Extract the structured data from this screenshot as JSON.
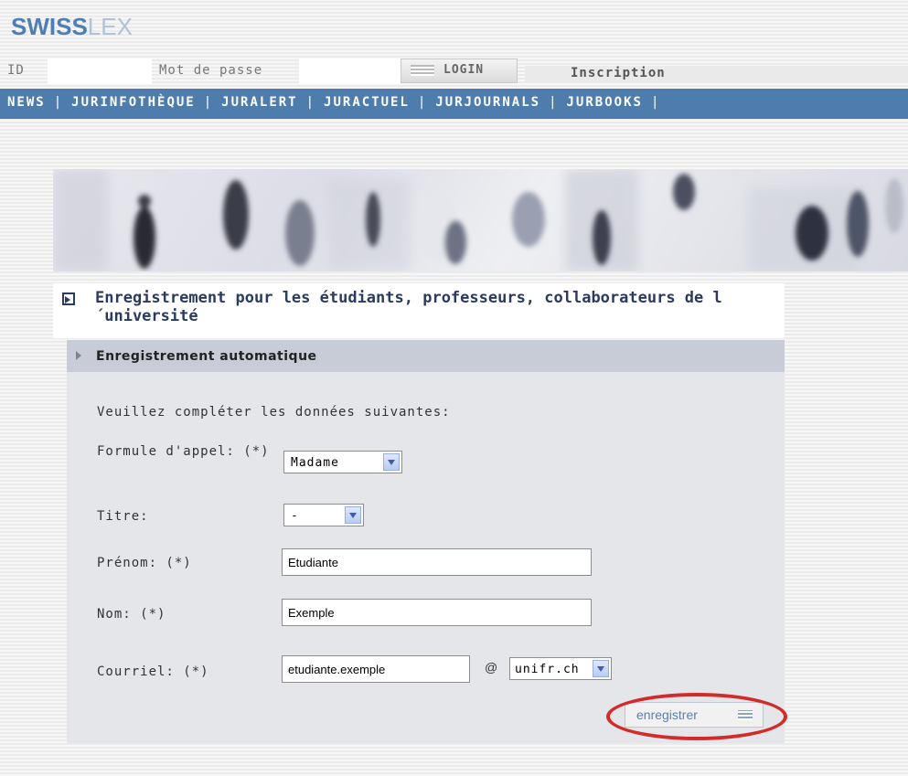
{
  "header": {
    "logo_part1": "SWISS",
    "logo_part2": "LEX",
    "id_label": "ID",
    "id_value": "",
    "password_label": "Mot de passe",
    "password_value": "",
    "login_label": "LOGIN",
    "inscription_label": "Inscription"
  },
  "nav": {
    "items": [
      "NEWS",
      "JURINFOTHÈQUE",
      "JURALERT",
      "JURACTUEL",
      "JURJOURNALS",
      "JURBOOKS"
    ],
    "separator": "|"
  },
  "page": {
    "title": "Enregistrement pour les étudiants, professeurs, collaborateurs de l´université",
    "section_title": "Enregistrement automatique",
    "intro": "Veuillez compléter les données suivantes:"
  },
  "form": {
    "salutation_label": "Formule d'appel: (*)",
    "salutation_value": "Madame",
    "title_label": "Titre:",
    "title_value": "-",
    "firstname_label": "Prénom: (*)",
    "firstname_value": "Etudiante",
    "lastname_label": "Nom: (*)",
    "lastname_value": "Exemple",
    "email_label": "Courriel: (*)",
    "email_user_value": "etudiante.exemple",
    "at_sign": "@",
    "email_domain_value": "unifr.ch",
    "submit_label": "enregistrer"
  },
  "colors": {
    "nav_bg": "#4d7cad",
    "title_text": "#2a3a60",
    "highlight_circle": "#d32a2a"
  }
}
